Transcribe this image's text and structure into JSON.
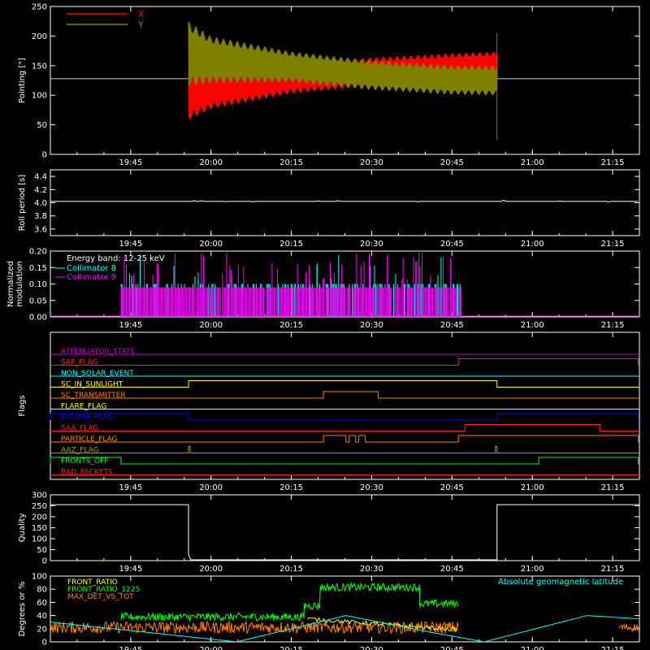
{
  "time_ticks": [
    "19:45",
    "20:00",
    "20:15",
    "20:30",
    "20:45",
    "21:00",
    "21:15"
  ],
  "time_tick_hours": [
    19.75,
    20.0,
    20.25,
    20.5,
    20.75,
    21.0,
    21.25
  ],
  "time_range_hours": [
    19.5,
    21.3333
  ],
  "colors": {
    "axis": "#ffffff",
    "x": "#ff0000",
    "y": "#808000",
    "cyan": "#00ffff",
    "magenta": "#ff00ff",
    "green": "#00ff00",
    "orange": "#ff8000",
    "yellow": "#ffff00",
    "blue": "#0000ff",
    "red": "#ff2020",
    "ltgreen": "#c0ff60",
    "olive": "#a0a000",
    "purple": "#c000c0"
  },
  "chart_data": [
    {
      "type": "line",
      "ylabel": "Pointing [\"]",
      "ylim": [
        0,
        250
      ],
      "yticks": [
        "0",
        "50",
        "100",
        "150",
        "200",
        "250"
      ],
      "yticks_values": [
        0,
        50,
        100,
        150,
        200,
        250
      ],
      "baseline": 128,
      "active_range_hours": [
        19.93,
        20.89
      ],
      "series": [
        {
          "name": "X",
          "color": "#ff0000",
          "x_hours": [
            19.93,
            20.0,
            20.25,
            20.5,
            20.75,
            20.89
          ],
          "center": [
            100,
            110,
            128,
            140,
            147,
            150
          ],
          "amplitude": [
            42,
            33,
            25,
            24,
            24,
            24
          ]
        },
        {
          "name": "Y",
          "color": "#808000",
          "x_hours": [
            19.93,
            20.0,
            20.25,
            20.5,
            20.75,
            20.89
          ],
          "center": [
            170,
            160,
            148,
            134,
            126,
            125
          ],
          "amplitude": [
            55,
            40,
            26,
            25,
            25,
            25
          ]
        }
      ]
    },
    {
      "type": "line",
      "ylabel": "Roll period [s]",
      "ylim": [
        3.5,
        4.5
      ],
      "yticks": [
        "3.6",
        "3.8",
        "4.0",
        "4.2",
        "4.4"
      ],
      "yticks_values": [
        3.6,
        3.8,
        4.0,
        4.2,
        4.4
      ],
      "series": [
        {
          "value": 4.02,
          "color": "#ffffff"
        }
      ]
    },
    {
      "type": "bar",
      "ylabel": [
        "Normalized",
        "modulation"
      ],
      "ylim": [
        0,
        0.2
      ],
      "yticks": [
        "0.00",
        "0.05",
        "0.10",
        "0.15",
        "0.20"
      ],
      "yticks_values": [
        0.0,
        0.05,
        0.1,
        0.15,
        0.2
      ],
      "annotation": "Energy band: 12-25 keV",
      "active_range_hours": [
        19.72,
        20.78
      ],
      "series": [
        {
          "name": "Collimator 8",
          "color": "#00ffff",
          "typical": 0.1,
          "max": 0.19
        },
        {
          "name": "Collimator 9",
          "color": "#ff00ff",
          "typical": 0.09,
          "max": 0.2
        }
      ]
    },
    {
      "type": "step",
      "ylabel": "Flags",
      "flags": [
        {
          "name": "ATTENUATOR_STATE",
          "color": "#c000c0",
          "high_ranges": []
        },
        {
          "name": "SAP_FLAG",
          "color": "#ff2020",
          "high_ranges": [
            [
              20.77,
              21.33
            ]
          ]
        },
        {
          "name": "NON_SOLAR_EVENT",
          "color": "#00ffff",
          "high_ranges": []
        },
        {
          "name": "SC_IN_SUNLIGHT",
          "color": "#ffff00",
          "high_ranges": [
            [
              19.93,
              20.89
            ]
          ]
        },
        {
          "name": "SC_TRANSMITTER",
          "color": "#ff8000",
          "high_ranges": [
            [
              20.35,
              20.52
            ]
          ]
        },
        {
          "name": "FLARE_FLAG",
          "color": "#ffff00",
          "high_ranges": []
        },
        {
          "name": "ECLIPSE_FLAG",
          "color": "#0000ff",
          "high_ranges": [
            [
              19.5,
              19.93
            ],
            [
              20.89,
              21.33
            ]
          ]
        },
        {
          "name": "SAA_FLAG",
          "color": "#ff2020",
          "high_ranges": [
            [
              20.79,
              21.21
            ]
          ]
        },
        {
          "name": "PARTICLE_FLAG",
          "color": "#ff8000",
          "high_ranges": [
            [
              20.35,
              20.42
            ],
            [
              20.43,
              20.45
            ],
            [
              20.46,
              20.48
            ],
            [
              20.77,
              21.33
            ]
          ]
        },
        {
          "name": "AAZ_FLAG",
          "color": "#a0a000",
          "high_ranges": [
            [
              19.93,
              19.935
            ],
            [
              20.885,
              20.89
            ]
          ]
        },
        {
          "name": "FRONTS_OFF",
          "color": "#00ff00",
          "high_ranges": [
            [
              19.5,
              19.72
            ],
            [
              21.02,
              21.33
            ]
          ]
        },
        {
          "name": "BAD_PACKETS",
          "color": "#ff2020",
          "high_ranges": []
        }
      ]
    },
    {
      "type": "line",
      "ylabel": "Quality",
      "ylim": [
        0,
        300
      ],
      "yticks": [
        "0",
        "50",
        "100",
        "150",
        "200",
        "250",
        "300"
      ],
      "yticks_values": [
        0,
        50,
        100,
        150,
        200,
        250,
        300
      ],
      "series": [
        {
          "color": "#ffffff",
          "high_value": 255,
          "high_ranges": [
            [
              19.5,
              19.93
            ],
            [
              20.89,
              21.33
            ]
          ]
        }
      ]
    },
    {
      "type": "line",
      "ylabel": "Degrees or %",
      "ylim": [
        0,
        100
      ],
      "yticks": [
        "0",
        "20",
        "40",
        "60",
        "80",
        "100"
      ],
      "yticks_values": [
        0,
        20,
        40,
        60,
        80,
        100
      ],
      "annotation": "Absolute geomagnetic latitude",
      "series": [
        {
          "name": "FRONT_RATIO",
          "color": "#ffff00"
        },
        {
          "name": "FRONT_RATIO_1225",
          "color": "#00ff00",
          "segments": [
            {
              "range": [
                19.72,
                20.29
              ],
              "level": 38
            },
            {
              "range": [
                20.29,
                20.34
              ],
              "level": 55
            },
            {
              "range": [
                20.34,
                20.65
              ],
              "level": 83
            },
            {
              "range": [
                20.65,
                20.77
              ],
              "level": 58
            }
          ]
        },
        {
          "name": "MAX_DET_VS_TOT",
          "color": "#ff8000",
          "level": 22,
          "range": [
            19.5,
            20.77
          ]
        },
        {
          "name": "Absolute geomagnetic latitude",
          "color": "#00ffff",
          "x_hours": [
            19.5,
            19.85,
            20.08,
            20.42,
            20.68,
            20.85,
            21.17,
            21.333
          ],
          "y": [
            30,
            12,
            0,
            40,
            15,
            0,
            40,
            35
          ]
        }
      ]
    }
  ]
}
